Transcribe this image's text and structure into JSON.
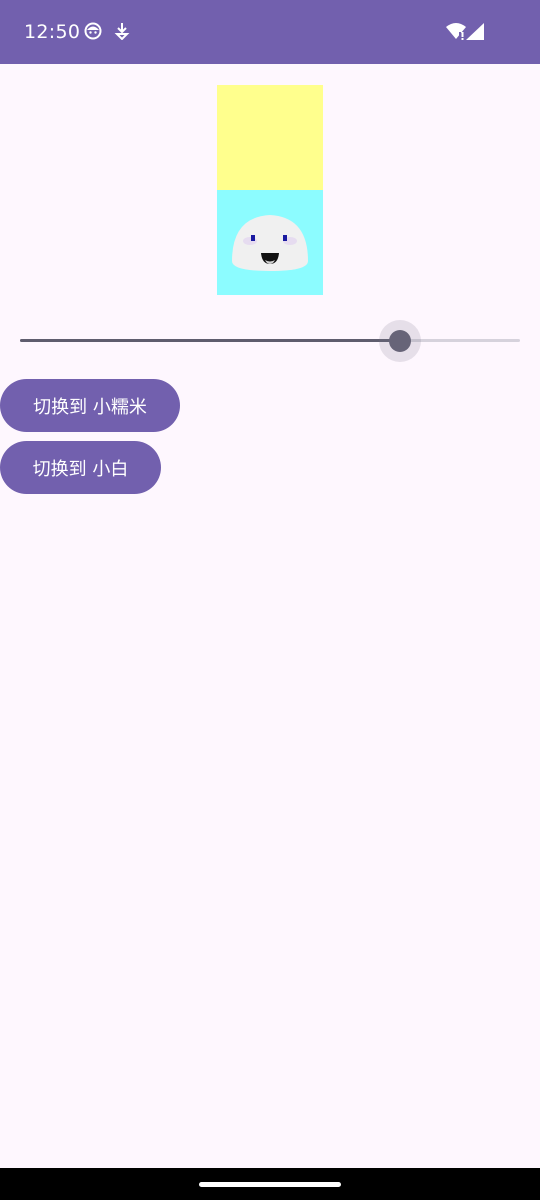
{
  "status_bar": {
    "time": "12:50",
    "background": "#7260ae",
    "left_icons": [
      "face-notification-icon",
      "download-notification-icon"
    ],
    "right_icons": [
      "wifi-icon",
      "signal-icon"
    ]
  },
  "preview": {
    "top_color": "#ffff8d",
    "bottom_color": "#8cfcff",
    "character_icon": "mochi-face-icon"
  },
  "slider": {
    "value_fraction": 0.76,
    "active_color": "#5f5d6e",
    "inactive_color": "#d6d2dc"
  },
  "buttons": {
    "switch_to_mochi_label": "切换到 小糯米",
    "switch_to_xiaobai_label": "切换到 小白",
    "color": "#7260ae"
  },
  "nav_bar": {
    "handle_icon": "home-gesture-handle"
  }
}
